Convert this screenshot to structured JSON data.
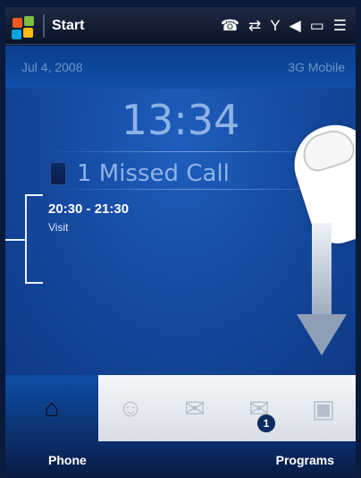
{
  "colors": {
    "accent": "#0f4fa8",
    "titlebar": "#0b1326"
  },
  "titlebar": {
    "title": "Start",
    "status_icons": [
      "missed-call-icon",
      "sync-icon",
      "signal-icon",
      "volume-icon",
      "battery-icon",
      "menu-icon"
    ]
  },
  "subheader": {
    "date": "Jul 4, 2008",
    "carrier": "3G Mobile"
  },
  "home": {
    "time": "13:34",
    "missed": "1 Missed Call",
    "appointment": {
      "time_range": "20:30 - 21:30",
      "subject": "Visit"
    }
  },
  "tabs": [
    {
      "name": "home-tab",
      "icon": "house-icon",
      "active": true
    },
    {
      "name": "people-tab",
      "icon": "person-icon"
    },
    {
      "name": "mail-tab",
      "icon": "envelope-icon"
    },
    {
      "name": "messages-tab",
      "icon": "message-icon",
      "badge": "1"
    },
    {
      "name": "photos-tab",
      "icon": "photos-icon"
    }
  ],
  "softkeys": {
    "left": "Phone",
    "right": "Programs"
  }
}
